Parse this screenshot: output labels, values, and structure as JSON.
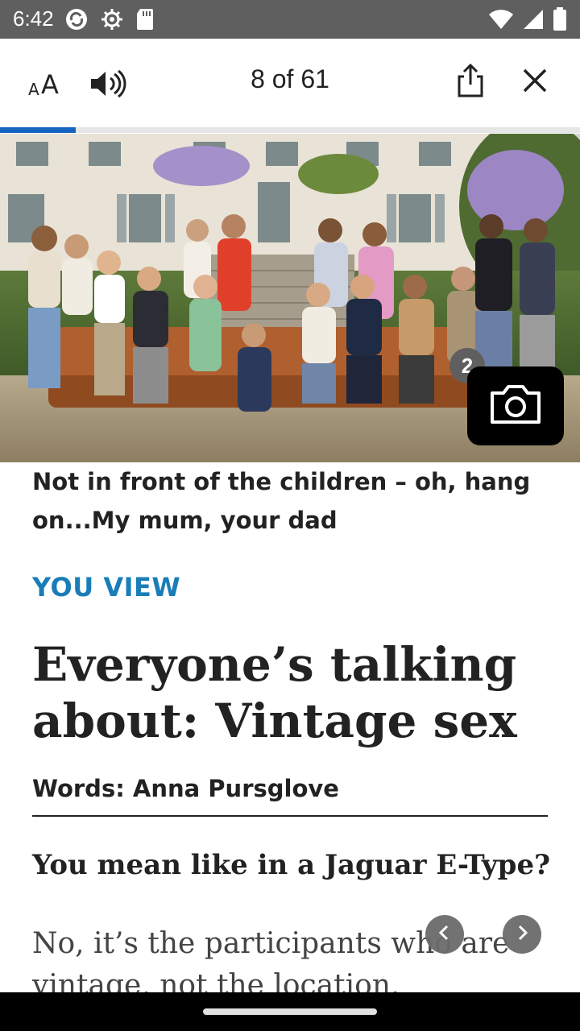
{
  "status_bar": {
    "time": "6:42",
    "left_icons": [
      "sync-icon",
      "gear-icon",
      "sd-card-icon"
    ],
    "right_icons": [
      "wifi-icon",
      "cellular-signal-icon",
      "battery-icon"
    ]
  },
  "toolbar": {
    "text_size_icon": "text-size-icon",
    "audio_icon": "speaker-icon",
    "page_counter": "8 of 61",
    "share_icon": "share-icon",
    "close_icon": "close-icon",
    "progress": 0.131
  },
  "hero": {
    "photo_count": "2",
    "badge_icon": "camera-icon"
  },
  "article": {
    "caption": "Not in front of the children – oh, hang on...My mum, your dad",
    "section": "YOU VIEW",
    "headline": "Everyone’s talking about: Vintage sex",
    "byline": "Words: Anna Pursglove",
    "subhead": "You mean like in a Jaguar E-Type?",
    "body": "No, it’s the participants who are vintage, not the location."
  },
  "colors": {
    "accent": "#1a7db8",
    "progress": "#1565c0",
    "status_bar": "#5f5f5f"
  }
}
